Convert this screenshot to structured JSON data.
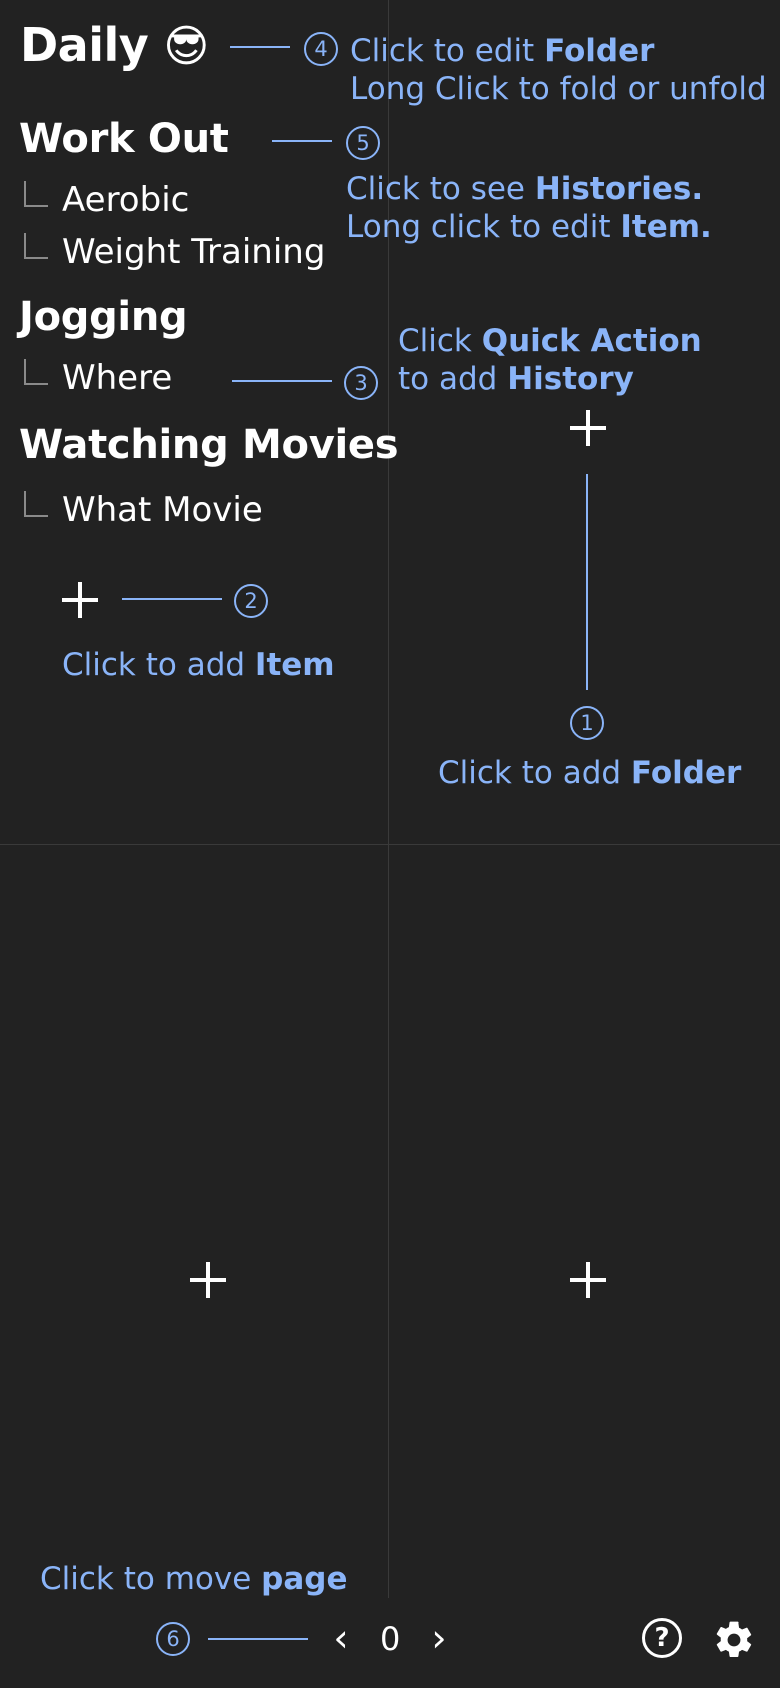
{
  "panel": {
    "title": "Daily",
    "title_emoji": "😎",
    "folders": [
      {
        "name": "Work Out",
        "items": [
          "Aerobic",
          "Weight Training"
        ]
      },
      {
        "name": "Jogging",
        "items": [
          "Where"
        ]
      },
      {
        "name": "Watching Movies",
        "items": [
          "What Movie"
        ]
      }
    ]
  },
  "hints": {
    "h1": {
      "num": "1",
      "pre": "Click to add ",
      "bold": "Folder"
    },
    "h2": {
      "num": "2",
      "pre": "Click to add ",
      "bold": "Item"
    },
    "h3": {
      "num": "3",
      "pre1": "Click ",
      "bold1": "Quick Action",
      "pre2": "to add ",
      "bold2": "History"
    },
    "h4": {
      "num": "4",
      "pre1": "Click to edit ",
      "bold1": "Folder",
      "line2": "Long Click to fold or unfold"
    },
    "h5": {
      "num": "5",
      "pre1": "Click to see ",
      "bold1": "Histories.",
      "pre2": "Long click to edit ",
      "bold2": "Item."
    },
    "h6": {
      "num": "6",
      "pre": "Click to move ",
      "bold": "page"
    }
  },
  "footer": {
    "prev": "‹",
    "page": "0",
    "next": "›",
    "help": "?"
  },
  "colors": {
    "background": "#222222",
    "accent": "#8ab4f8",
    "text": "#ffffff"
  },
  "icons": [
    "plus-icon",
    "chevron-left-icon",
    "chevron-right-icon",
    "help-icon",
    "gear-icon"
  ]
}
